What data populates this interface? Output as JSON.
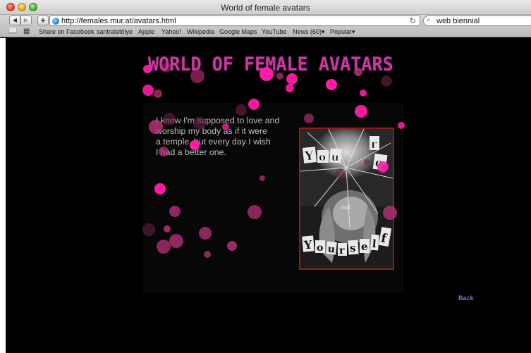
{
  "window": {
    "title": "World of female avatars"
  },
  "toolbar": {
    "back_glyph": "◀",
    "forward_glyph": "▶",
    "add_glyph": "+",
    "url": "http://females.mur.at/avatars.html",
    "reload_glyph": "↻",
    "search_value": "web biennial",
    "search_glyph": "⌕"
  },
  "bookmarks": {
    "book_glyph": "📖",
    "grid_glyph": "▦",
    "items": [
      {
        "label": "Share on Facebook"
      },
      {
        "label": "santralatölye"
      },
      {
        "label": "Apple"
      },
      {
        "label": "Yahoo!"
      },
      {
        "label": "Wikipedia"
      },
      {
        "label": "Google Maps"
      },
      {
        "label": "YouTube"
      },
      {
        "label": "News (60)▾"
      },
      {
        "label": "Popular▾"
      }
    ]
  },
  "page": {
    "title": "WORLD OF FEMALE AVATARS",
    "quote_lines": [
      "I know I'm supposed to love and",
      "worship my body as if it were",
      "a temple, but every day I wish",
      "I had a better one."
    ],
    "artwork": {
      "top_words": "Your're",
      "middle_word": "not",
      "bottom_word": "yourself"
    },
    "back_label": "Back"
  },
  "colors": {
    "title": "#c63aa0",
    "bubble_bright": "#ff1ba8",
    "bubble_mid": "#c2337f",
    "bubble_dark": "#6b2248",
    "link": "#7b7bd8",
    "frame": "#8b1d1d"
  }
}
